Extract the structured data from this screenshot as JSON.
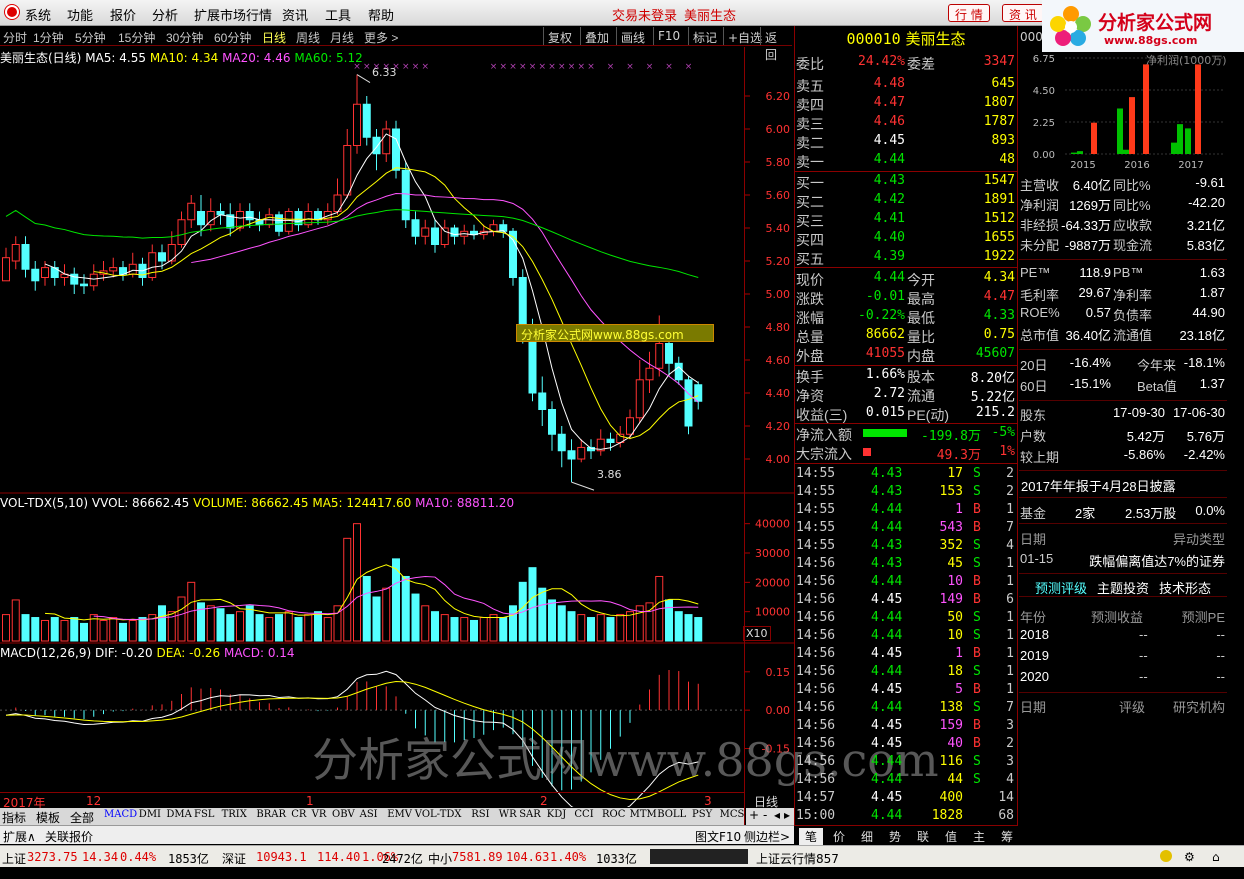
{
  "menu": {
    "items": [
      "系统",
      "功能",
      "报价",
      "分析",
      "扩展市场行情",
      "资讯",
      "工具",
      "帮助"
    ],
    "status": "交易未登录",
    "stock": "美丽生态",
    "btn1": "行 情",
    "btn2": "资 讯"
  },
  "logo": {
    "title": "分析家公式网",
    "url": "www.88gs.com"
  },
  "periods": [
    "分时",
    "1分钟",
    "5分钟",
    "15分钟",
    "30分钟",
    "60分钟",
    "日线",
    "周线",
    "月线",
    "更多 >"
  ],
  "active_period": "日线",
  "tools": [
    "复权",
    "叠加",
    "画线",
    "F10",
    "标记",
    "+自选",
    "返回"
  ],
  "chart": {
    "title": "美丽生态(日线)",
    "ma5": "MA5: 4.55",
    "ma10": "MA10: 4.34",
    "ma20": "MA20: 4.46",
    "ma60": "MA60: 5.12",
    "high_label": "6.33",
    "low_label": "3.86",
    "vol_title": "VOL-TDX(5,10)",
    "vvol": "VVOL: 86662.45",
    "volume": "VOLUME: 86662.45",
    "vma5": "MA5: 124417.60",
    "vma10": "MA10: 88811.20",
    "macd_title": "MACD(12,26,9)",
    "dif": "DIF: -0.20",
    "dea": "DEA: -0.26",
    "macd": "MACD: 0.14",
    "x10": "X10",
    "dl": "日线",
    "year": "2017年",
    "m1": "12",
    "m2": "1",
    "m3": "2",
    "m4": "3",
    "watermark": "分析家公式网www.88gs.com",
    "banner": "分析家公式网www.88gs.com",
    "price_axis": [
      "6.20",
      "6.00",
      "5.80",
      "5.60",
      "5.40",
      "5.20",
      "5.00",
      "4.80",
      "4.60",
      "4.40",
      "4.20",
      "4.00"
    ],
    "vol_axis": [
      "40000",
      "30000",
      "20000",
      "10000"
    ],
    "macd_axis": [
      "0.15",
      "0.00",
      "-0.15"
    ]
  },
  "chart_data": {
    "type": "candlestick",
    "ylim": [
      3.8,
      6.4
    ],
    "candles": [
      [
        5.08,
        5.22,
        5.1,
        5.28
      ],
      [
        5.2,
        5.3,
        5.15,
        5.35
      ],
      [
        5.3,
        5.15,
        5.1,
        5.35
      ],
      [
        5.15,
        5.08,
        5.02,
        5.2
      ],
      [
        5.1,
        5.16,
        5.05,
        5.2
      ],
      [
        5.16,
        5.1,
        5.05,
        5.2
      ],
      [
        5.1,
        5.12,
        5.05,
        5.18
      ],
      [
        5.12,
        5.06,
        5.0,
        5.16
      ],
      [
        5.06,
        5.05,
        5.0,
        5.12
      ],
      [
        5.05,
        5.12,
        5.02,
        5.18
      ],
      [
        5.12,
        5.14,
        5.08,
        5.2
      ],
      [
        5.14,
        5.16,
        5.1,
        5.22
      ],
      [
        5.16,
        5.12,
        5.08,
        5.2
      ],
      [
        5.12,
        5.18,
        5.1,
        5.25
      ],
      [
        5.18,
        5.1,
        5.05,
        5.22
      ],
      [
        5.1,
        5.25,
        5.08,
        5.3
      ],
      [
        5.25,
        5.2,
        5.15,
        5.3
      ],
      [
        5.2,
        5.3,
        5.18,
        5.38
      ],
      [
        5.3,
        5.45,
        5.28,
        5.5
      ],
      [
        5.45,
        5.55,
        5.4,
        5.6
      ],
      [
        5.5,
        5.42,
        5.35,
        5.6
      ],
      [
        5.42,
        5.5,
        5.38,
        5.58
      ],
      [
        5.5,
        5.48,
        5.42,
        5.55
      ],
      [
        5.48,
        5.4,
        5.35,
        5.55
      ],
      [
        5.4,
        5.5,
        5.38,
        5.55
      ],
      [
        5.5,
        5.45,
        5.4,
        5.55
      ],
      [
        5.45,
        5.42,
        5.38,
        5.5
      ],
      [
        5.42,
        5.48,
        5.4,
        5.52
      ],
      [
        5.48,
        5.38,
        5.35,
        5.5
      ],
      [
        5.38,
        5.5,
        5.36,
        5.52
      ],
      [
        5.5,
        5.42,
        5.38,
        5.52
      ],
      [
        5.42,
        5.5,
        5.4,
        5.55
      ],
      [
        5.5,
        5.45,
        5.42,
        5.52
      ],
      [
        5.45,
        5.5,
        5.42,
        5.55
      ],
      [
        5.5,
        5.6,
        5.48,
        5.7
      ],
      [
        5.6,
        5.9,
        5.58,
        6.0
      ],
      [
        5.9,
        6.15,
        5.85,
        6.33
      ],
      [
        6.15,
        5.95,
        5.9,
        6.2
      ],
      [
        5.95,
        5.85,
        5.75,
        6.0
      ],
      [
        5.85,
        6.0,
        5.8,
        6.05
      ],
      [
        6.0,
        5.75,
        5.7,
        6.05
      ],
      [
        5.75,
        5.45,
        5.4,
        5.8
      ],
      [
        5.45,
        5.35,
        5.3,
        5.5
      ],
      [
        5.35,
        5.4,
        5.3,
        5.45
      ],
      [
        5.4,
        5.3,
        5.25,
        5.45
      ],
      [
        5.3,
        5.4,
        5.28,
        5.45
      ],
      [
        5.4,
        5.35,
        5.3,
        5.42
      ],
      [
        5.35,
        5.38,
        5.3,
        5.42
      ],
      [
        5.38,
        5.36,
        5.33,
        5.42
      ],
      [
        5.36,
        5.38,
        5.33,
        5.42
      ],
      [
        5.38,
        5.42,
        5.35,
        5.45
      ],
      [
        5.42,
        5.38,
        5.34,
        5.45
      ],
      [
        5.38,
        5.1,
        5.05,
        5.4
      ],
      [
        5.1,
        4.8,
        4.7,
        5.15
      ],
      [
        4.8,
        4.4,
        4.35,
        4.85
      ],
      [
        4.4,
        4.3,
        4.2,
        4.5
      ],
      [
        4.3,
        4.15,
        4.05,
        4.35
      ],
      [
        4.15,
        4.05,
        3.95,
        4.2
      ],
      [
        4.05,
        4.0,
        3.86,
        4.12
      ],
      [
        4.0,
        4.07,
        3.98,
        4.12
      ],
      [
        4.07,
        4.05,
        4.0,
        4.12
      ],
      [
        4.05,
        4.12,
        4.02,
        4.18
      ],
      [
        4.12,
        4.1,
        4.05,
        4.16
      ],
      [
        4.1,
        4.15,
        4.07,
        4.2
      ],
      [
        4.15,
        4.25,
        4.12,
        4.3
      ],
      [
        4.25,
        4.48,
        4.22,
        4.6
      ],
      [
        4.48,
        4.55,
        4.4,
        4.65
      ],
      [
        4.55,
        4.7,
        4.5,
        4.87
      ],
      [
        4.7,
        4.58,
        4.5,
        4.8
      ],
      [
        4.58,
        4.48,
        4.45,
        4.62
      ],
      [
        4.48,
        4.2,
        4.15,
        4.5
      ],
      [
        4.45,
        4.35,
        4.3,
        4.47
      ]
    ],
    "volumes": [
      9000,
      14000,
      9000,
      8000,
      7000,
      8000,
      7000,
      8000,
      6000,
      9000,
      7000,
      8000,
      6000,
      7000,
      8000,
      9000,
      12000,
      10000,
      15000,
      20000,
      13000,
      12000,
      11000,
      9000,
      10000,
      12000,
      9000,
      8000,
      9000,
      10000,
      8000,
      9000,
      10000,
      8000,
      12000,
      35000,
      40000,
      22000,
      15000,
      18000,
      28000,
      22000,
      16000,
      12000,
      10000,
      9000,
      8000,
      8000,
      7000,
      8000,
      9000,
      8000,
      12000,
      20000,
      25000,
      18000,
      14000,
      12000,
      10000,
      9000,
      8000,
      9000,
      8000,
      9000,
      10000,
      12000,
      13000,
      22000,
      14000,
      10000,
      9000,
      8000
    ]
  },
  "quote": {
    "code": "000010",
    "name": "美丽生态",
    "wb_label": "委比",
    "wb": "24.42%",
    "wc_label": "委差",
    "wc": "3347",
    "asks": [
      {
        "label": "卖五",
        "price": "4.48",
        "vol": "645"
      },
      {
        "label": "卖四",
        "price": "4.47",
        "vol": "1807"
      },
      {
        "label": "卖三",
        "price": "4.46",
        "vol": "1787"
      },
      {
        "label": "卖二",
        "price": "4.45",
        "vol": "893"
      },
      {
        "label": "卖一",
        "price": "4.44",
        "vol": "48"
      }
    ],
    "bids": [
      {
        "label": "买一",
        "price": "4.43",
        "vol": "1547"
      },
      {
        "label": "买二",
        "price": "4.42",
        "vol": "1891"
      },
      {
        "label": "买三",
        "price": "4.41",
        "vol": "1512"
      },
      {
        "label": "买四",
        "price": "4.40",
        "vol": "1655"
      },
      {
        "label": "买五",
        "price": "4.39",
        "vol": "1922"
      }
    ],
    "stats": [
      [
        "现价",
        "4.44",
        "今开",
        "4.34"
      ],
      [
        "涨跌",
        "-0.01",
        "最高",
        "4.47"
      ],
      [
        "涨幅",
        "-0.22%",
        "最低",
        "4.33"
      ],
      [
        "总量",
        "86662",
        "量比",
        "0.75"
      ],
      [
        "外盘",
        "41055",
        "内盘",
        "45607"
      ]
    ],
    "stats2": [
      [
        "换手",
        "1.66%",
        "股本",
        "8.20亿"
      ],
      [
        "净资",
        "2.72",
        "流通",
        "5.22亿"
      ],
      [
        "收益(三)",
        "0.015",
        "PE(动)",
        "215.2"
      ]
    ],
    "flow1": [
      "净流入额",
      "-199.8万",
      "-5%"
    ],
    "flow2": [
      "大宗流入",
      "49.3万",
      "1%"
    ]
  },
  "ticks": [
    [
      "14:55",
      "4.43",
      "17",
      "S",
      "2"
    ],
    [
      "14:55",
      "4.43",
      "153",
      "S",
      "2"
    ],
    [
      "14:55",
      "4.44",
      "1",
      "B",
      "1"
    ],
    [
      "14:55",
      "4.44",
      "543",
      "B",
      "7"
    ],
    [
      "14:55",
      "4.43",
      "352",
      "S",
      "4"
    ],
    [
      "14:56",
      "4.43",
      "45",
      "S",
      "1"
    ],
    [
      "14:56",
      "4.44",
      "10",
      "B",
      "1"
    ],
    [
      "14:56",
      "4.45",
      "149",
      "B",
      "6"
    ],
    [
      "14:56",
      "4.44",
      "50",
      "S",
      "1"
    ],
    [
      "14:56",
      "4.44",
      "10",
      "S",
      "1"
    ],
    [
      "14:56",
      "4.45",
      "1",
      "B",
      "1"
    ],
    [
      "14:56",
      "4.44",
      "18",
      "S",
      "1"
    ],
    [
      "14:56",
      "4.45",
      "5",
      "B",
      "1"
    ],
    [
      "14:56",
      "4.44",
      "138",
      "S",
      "7"
    ],
    [
      "14:56",
      "4.45",
      "159",
      "B",
      "3"
    ],
    [
      "14:56",
      "4.45",
      "40",
      "B",
      "2"
    ],
    [
      "14:56",
      "4.44",
      "116",
      "S",
      "3"
    ],
    [
      "14:56",
      "4.44",
      "44",
      "S",
      "4"
    ],
    [
      "14:57",
      "4.45",
      "400",
      "",
      "14"
    ],
    [
      "15:00",
      "4.44",
      "1828",
      "",
      "68"
    ]
  ],
  "fin": {
    "code": "000",
    "chart_title": "净利润(1000万)",
    "years": [
      "2015",
      "2016",
      "2017"
    ],
    "yaxis": [
      "6.75",
      "4.50",
      "2.25",
      "0.00"
    ],
    "bars": [
      0.1,
      0.2,
      2.2,
      3.2,
      0.3,
      4.0,
      6.3,
      0.8,
      2.1,
      1.8,
      6.3
    ],
    "rows": [
      [
        "主营收",
        "6.40亿",
        "同比%",
        "-9.61"
      ],
      [
        "净利润",
        "1269万",
        "同比%",
        "-42.20"
      ],
      [
        "非经损",
        "-64.33万",
        "应收款",
        "3.21亿"
      ],
      [
        "未分配",
        "-9887万",
        "现金流",
        "5.83亿"
      ]
    ],
    "rows2": [
      [
        "PE™",
        "118.9",
        "PB™",
        "1.63"
      ],
      [
        "毛利率",
        "29.67",
        "净利率",
        "1.87"
      ],
      [
        "ROE%",
        "0.57",
        "负债率",
        "44.90"
      ],
      [
        "总市值",
        "36.40亿",
        "流通值",
        "23.18亿"
      ]
    ],
    "rows3": [
      [
        "20日",
        "-16.4%",
        "今年来",
        "-18.1%"
      ],
      [
        "60日",
        "-15.1%",
        "Beta值",
        "1.37"
      ]
    ],
    "rows4": [
      [
        "股东",
        "17-09-30",
        "17-06-30"
      ],
      [
        "户数",
        "5.42万",
        "5.76万"
      ],
      [
        "较上期",
        "-5.86%",
        "-2.42%"
      ]
    ],
    "report": "2017年年报于4月28日披露",
    "fund": [
      "基金",
      "2家",
      "2.53万股",
      "0.0%"
    ],
    "event_h": [
      "日期",
      "异动类型"
    ],
    "event": [
      "01-15",
      "跌幅偏离值达7%的证券"
    ],
    "tabs": [
      "预测评级",
      "主题投资",
      "技术形态"
    ],
    "fc_h": [
      "年份",
      "预测收益",
      "预测PE"
    ],
    "fc": [
      [
        "2018",
        "--",
        "--"
      ],
      [
        "2019",
        "--",
        "--"
      ],
      [
        "2020",
        "--",
        "--"
      ]
    ],
    "rt_h": [
      "日期",
      "评级",
      "研究机构"
    ]
  },
  "indicators": [
    "指标",
    "模板",
    "全部",
    "MACD",
    "DMI",
    "DMA",
    "FSL",
    "TRIX",
    "BRAR",
    "CR",
    "VR",
    "OBV",
    "ASI",
    "EMV",
    "VOL-TDX",
    "RSI",
    "WR",
    "SAR",
    "KDJ",
    "CCI",
    "ROC",
    "MTM",
    "BOLL",
    "PSY",
    "MCST"
  ],
  "bottom": {
    "ext": "扩展∧",
    "rel": "关联报价",
    "f10": "图文F10",
    "side": "侧边栏>",
    "tabs": [
      "笔",
      "价",
      "细",
      "势",
      "联",
      "值",
      "主",
      "筹"
    ]
  },
  "status": {
    "sh": "上证",
    "sh_v": "3273.75",
    "sh_c": "14.34",
    "sh_p": "0.44%",
    "sh_a": "1853亿",
    "sz": "深证",
    "sz_v": "10943.1",
    "sz_c": "114.40",
    "sz_p": "1.06%",
    "sz_a": "2472亿",
    "zx": "中小",
    "zx_v": "7581.89",
    "zx_c": "104.63",
    "zx_p": "1.40%",
    "zx_a": "1033亿",
    "srv": "上证云行情857"
  }
}
